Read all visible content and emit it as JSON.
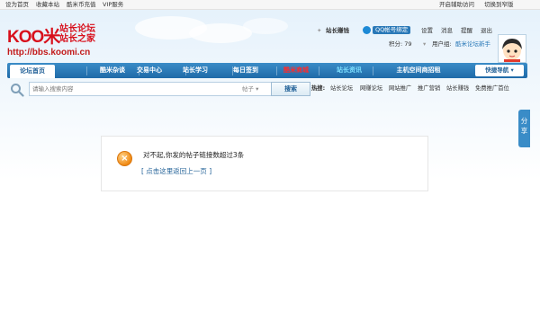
{
  "topbar": {
    "left_links": [
      "设为首页",
      "收藏本站",
      "酷米币充值",
      "VIP服务"
    ],
    "right_links": [
      "开启辅助访问",
      "切换到窄版"
    ]
  },
  "logo": {
    "brand": "KOO米",
    "line1": "站长论坛",
    "line2": "站长之家",
    "url": "http://bbs.koomi.cn"
  },
  "user": {
    "earn_label": "站长赚钱",
    "qq_bind": "QQ帐号绑定",
    "links": [
      "设置",
      "消息",
      "提醒",
      "退出"
    ],
    "points_label": "积分: 79",
    "group_label": "用户组:",
    "group_value": "酷米论坛新手"
  },
  "nav": {
    "items": [
      "论坛首页",
      "酷米杂谈",
      "交易中心",
      "站长学习",
      "每日签到",
      "酷米商城",
      "站长资讯",
      "主机空间商招租"
    ],
    "item_colors": [
      "#1f5f96",
      "#ffffff",
      "#ffffff",
      "#ffffff",
      "#ffffff",
      "#ff2a2a",
      "#7ee0ff",
      "#ffffff"
    ],
    "quick_nav": "快捷导航"
  },
  "search": {
    "placeholder": "请输入搜索内容",
    "type": "帖子",
    "button": "搜索",
    "hot_label": "热搜:",
    "hot_terms": [
      "站长论坛",
      "网赚论坛",
      "网站推广",
      "推广营销",
      "站长赚钱",
      "免费推广首位"
    ]
  },
  "message": {
    "text": "对不起,你发的帖子链接数超过3条",
    "back_link": "[ 点击这里返回上一页 ]"
  },
  "share": {
    "label": "分享"
  },
  "colors": {
    "nav_blue": "#2a79b8",
    "brand_red": "#d8101c",
    "link_blue": "#1f5f96",
    "warn_orange": "#f08a14"
  }
}
